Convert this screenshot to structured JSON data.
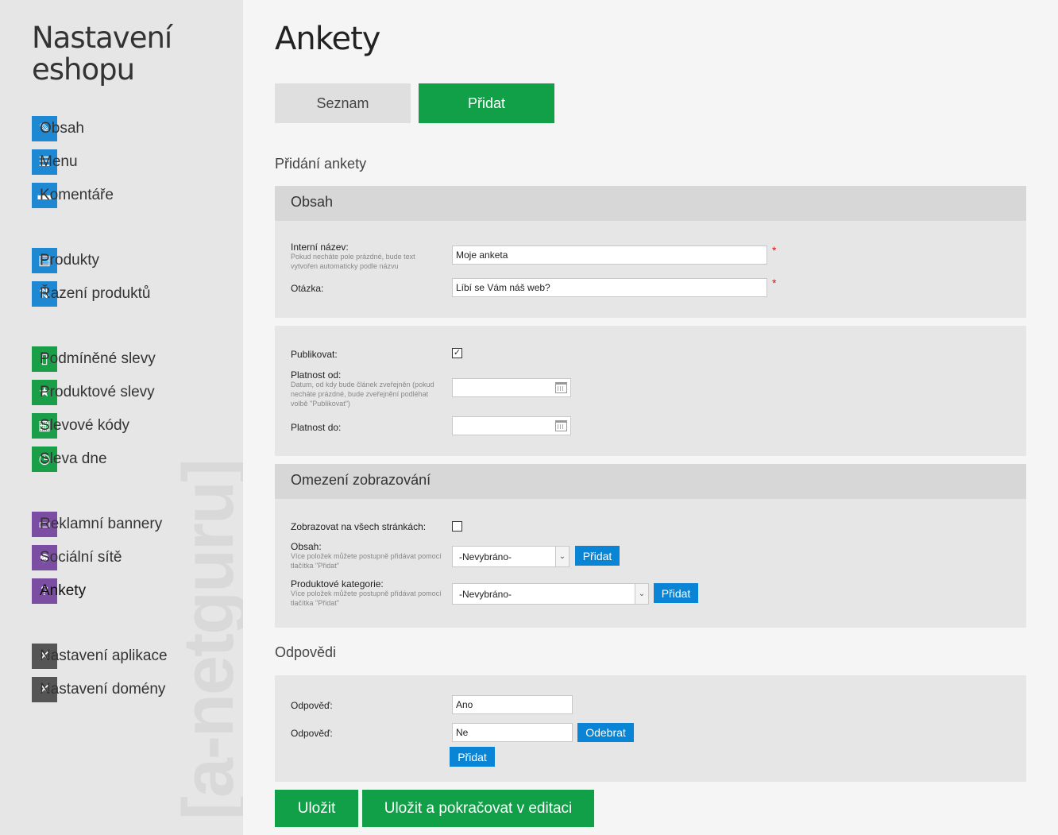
{
  "sidebar": {
    "title_line1": "Nastavení",
    "title_line2": "eshopu",
    "watermark": "[a-netguru]",
    "items": [
      {
        "label": "Obsah",
        "icon": "edit-icon"
      },
      {
        "label": "Menu",
        "icon": "menu-icon"
      },
      {
        "label": "Komentáře",
        "icon": "comment-icon"
      },
      {
        "label": "Produkty",
        "icon": "products-icon"
      },
      {
        "label": "Řazení produktů",
        "icon": "sort-icon"
      },
      {
        "label": "Podmíněné slevy",
        "icon": "conditional-discount-icon"
      },
      {
        "label": "Produktové slevy",
        "icon": "star-icon"
      },
      {
        "label": "Slevové kódy",
        "icon": "qr-code-icon"
      },
      {
        "label": "Sleva dne",
        "icon": "clock-icon"
      },
      {
        "label": "Reklamní bannery",
        "icon": "banner-icon"
      },
      {
        "label": "Sociální sítě",
        "icon": "social-icon"
      },
      {
        "label": "Ankety",
        "icon": "question-icon"
      },
      {
        "label": "Nastavení aplikace",
        "icon": "tools-icon"
      },
      {
        "label": "Nastavení domény",
        "icon": "tools-icon"
      }
    ]
  },
  "main": {
    "title": "Ankety",
    "tabs": {
      "list": "Seznam",
      "add": "Přidat"
    },
    "section_add": "Přidání ankety",
    "content_panel": {
      "heading": "Obsah",
      "internal_name_label": "Interní název:",
      "internal_name_hint": "Pokud necháte pole prázdné, bude text vytvořen automaticky podle názvu",
      "internal_name_value": "Moje anketa",
      "question_label": "Otázka:",
      "question_value": "Líbí se Vám náš web?",
      "required_mark": "*"
    },
    "publish_panel": {
      "publish_label": "Publikovat:",
      "publish_checked": true,
      "valid_from_label": "Platnost od:",
      "valid_from_hint": "Datum, od kdy bude článek zveřejněn (pokud necháte prázdné, bude zveřejnění podléhat volbě \"Publikovat\")",
      "valid_from_value": "",
      "valid_to_label": "Platnost do:",
      "valid_to_value": ""
    },
    "display_panel": {
      "heading": "Omezení zobrazování",
      "all_pages_label": "Zobrazovat na všech stránkách:",
      "all_pages_checked": false,
      "content_label": "Obsah:",
      "content_hint": "Více položek můžete postupně přidávat pomocí tlačítka \"Přidat\"",
      "content_select": "-Nevybráno-",
      "categories_label": "Produktové kategorie:",
      "categories_hint": "Více položek můžete postupně přidávat pomocí tlačítka \"Přidat\"",
      "categories_select": "-Nevybráno-",
      "add_button": "Přidat"
    },
    "answers": {
      "heading": "Odpovědi",
      "answer_label": "Odpověď:",
      "answer1": "Ano",
      "answer2": "Ne",
      "remove_button": "Odebrat",
      "add_button": "Přidat"
    },
    "buttons": {
      "save": "Uložit",
      "save_continue": "Uložit a pokračovat v editaci"
    }
  }
}
